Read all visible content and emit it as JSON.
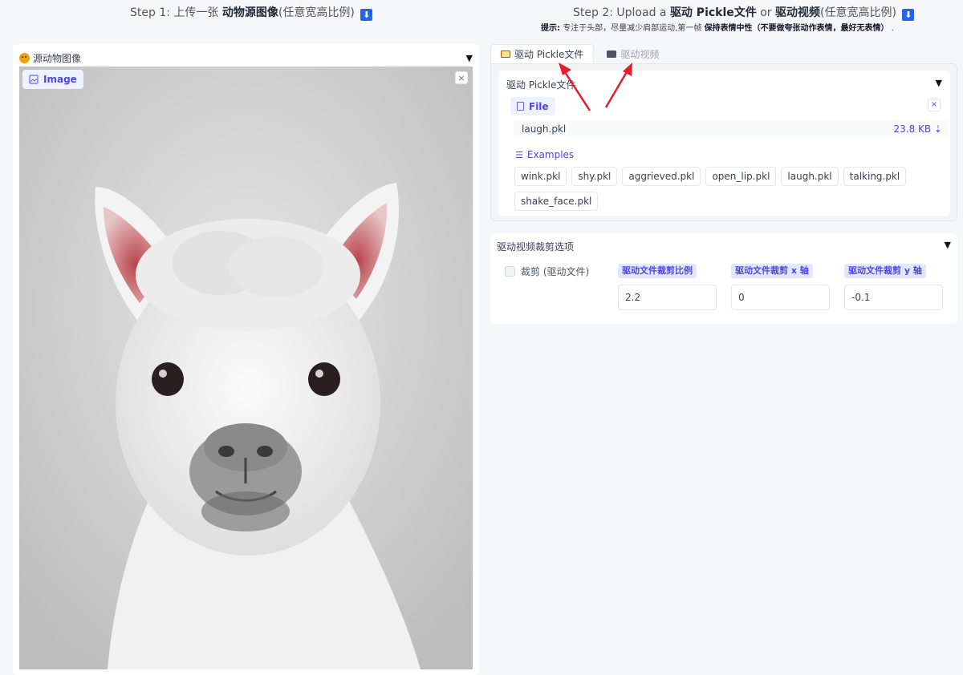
{
  "step1": {
    "prefix": "Step 1: 上传一张",
    "bold": "动物源图像",
    "suffix": "(任意宽高比例)",
    "badge": "⬇"
  },
  "step2": {
    "prefix": "Step 2: Upload a",
    "bold1": "驱动 Pickle文件",
    "mid": "or",
    "bold2": "驱动视频",
    "suffix": "(任意宽高比例)",
    "badge": "⬇"
  },
  "hint": {
    "lead": "提示:",
    "text": "专注于头部，尽量减少肩部运动,第一帧",
    "bold": "保持表情中性（不要做夸张动作表情，最好无表情）",
    "end": "."
  },
  "left_panel": {
    "title": "源动物图像",
    "image_badge": "Image",
    "close": "×"
  },
  "tabs": [
    {
      "label": "驱动 Pickle文件",
      "icon": "folder-icon"
    },
    {
      "label": "驱动视频",
      "icon": "film-icon"
    }
  ],
  "pickle": {
    "title": "驱动 Pickle文件",
    "file_badge": "File",
    "close": "×",
    "file_name": "laugh.pkl",
    "file_size": "23.8 KB ⇣",
    "examples_label": "Examples",
    "examples": [
      "wink.pkl",
      "shy.pkl",
      "aggrieved.pkl",
      "open_lip.pkl",
      "laugh.pkl",
      "talking.pkl",
      "shake_face.pkl"
    ]
  },
  "crop": {
    "title": "驱动视频裁剪选项",
    "checkbox_label": "裁剪 (驱动文件)",
    "fields": [
      {
        "label": "驱动文件裁剪比例",
        "value": "2.2"
      },
      {
        "label": "驱动文件裁剪 x 轴",
        "value": "0"
      },
      {
        "label": "驱动文件裁剪 y 轴",
        "value": "-0.1"
      }
    ]
  },
  "caret": "▼",
  "colors": {
    "accent": "#4f46e5",
    "arrow": "#e11d2e"
  }
}
